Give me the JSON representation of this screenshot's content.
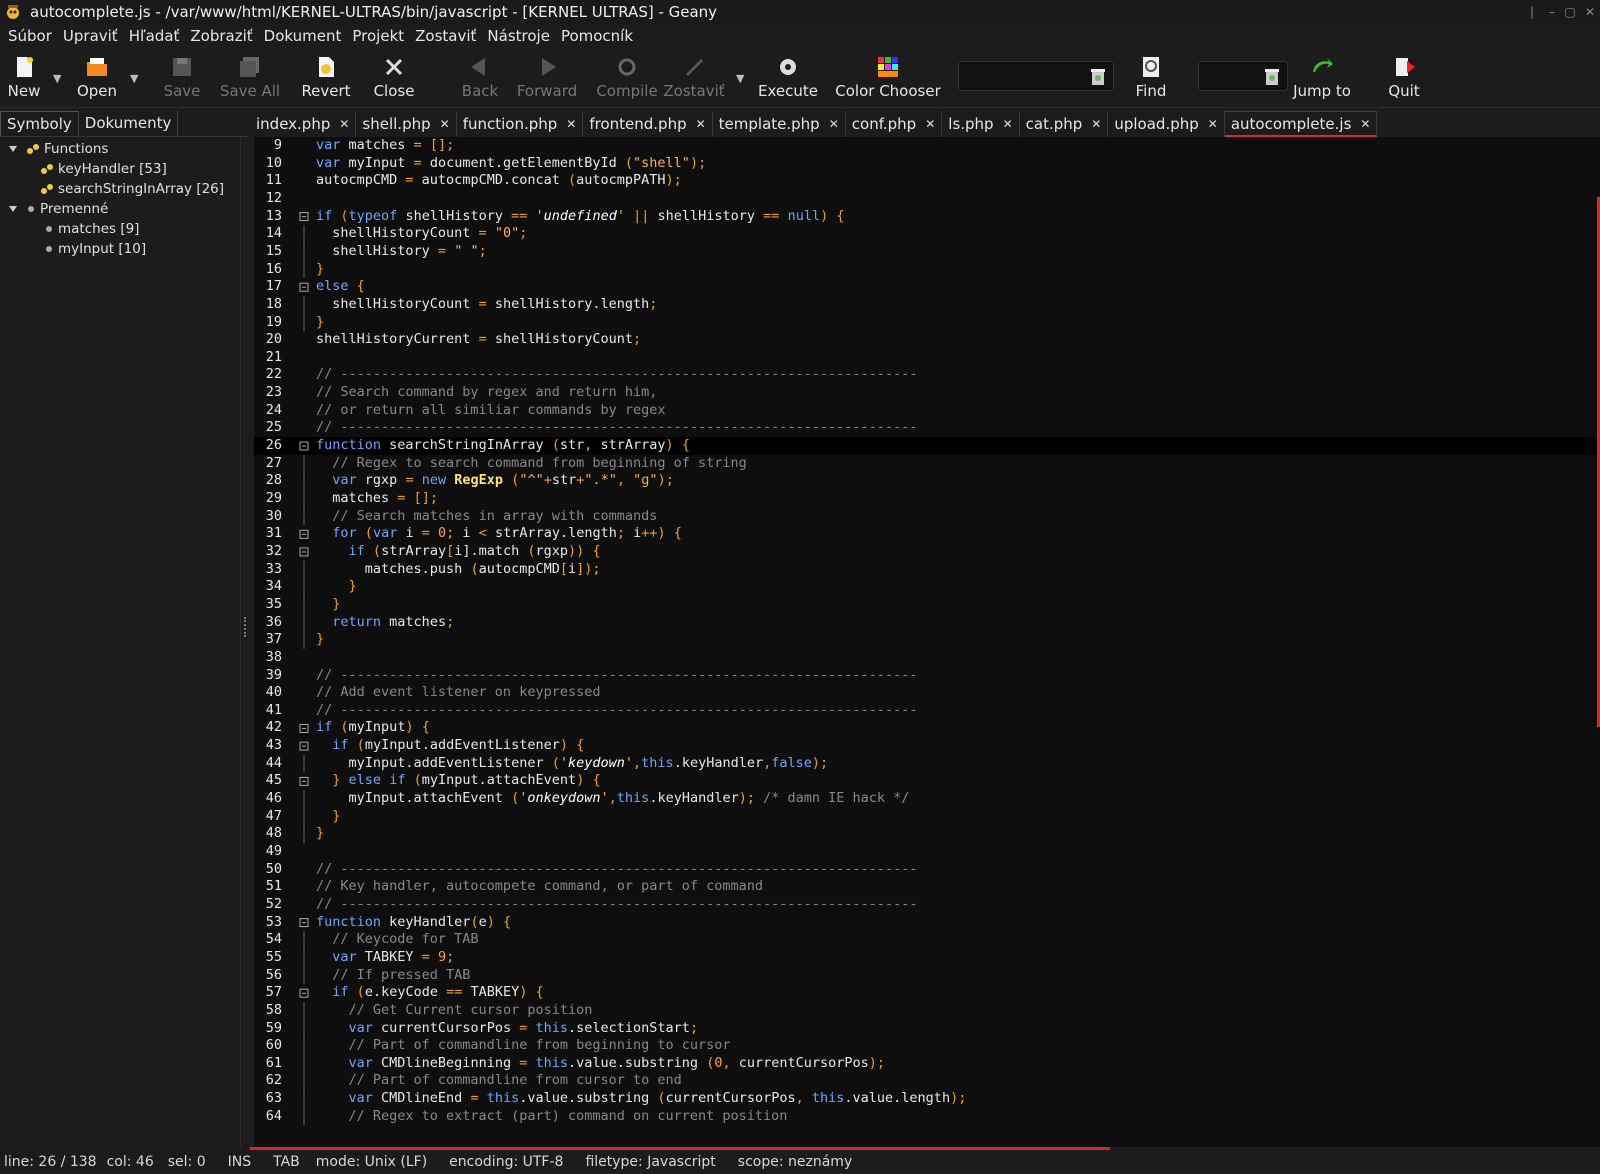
{
  "window": {
    "title": "autocomplete.js - /var/www/html/KERNEL-ULTRAS/bin/javascript - [KERNEL ULTRAS] - Geany"
  },
  "menu": [
    "Súbor",
    "Upraviť",
    "Hľadať",
    "Zobraziť",
    "Dokument",
    "Projekt",
    "Zostaviť",
    "Nástroje",
    "Pomocník"
  ],
  "toolbar": {
    "new": "New",
    "open": "Open",
    "save": "Save",
    "save_all": "Save All",
    "revert": "Revert",
    "close": "Close",
    "back": "Back",
    "forward": "Forward",
    "compile": "Compile",
    "build": "Zostaviť",
    "execute": "Execute",
    "color_chooser": "Color Chooser",
    "find": "Find",
    "jump_to": "Jump to",
    "quit": "Quit"
  },
  "sidebar": {
    "tabs": [
      "Symboly",
      "Dokumenty"
    ],
    "tree": {
      "functions_label": "Functions",
      "functions": [
        "keyHandler [53]",
        "searchStringInArray [26]"
      ],
      "variables_label": "Premenné",
      "variables": [
        "matches [9]",
        "myInput [10]"
      ]
    }
  },
  "doc_tabs": [
    "index.php",
    "shell.php",
    "function.php",
    "frontend.php",
    "template.php",
    "conf.php",
    "ls.php",
    "cat.php",
    "upload.php",
    "autocomplete.js"
  ],
  "editor": {
    "first_line": 9,
    "current_line": 26,
    "lines": [
      "var matches = [];",
      "var myInput = document.getElementById (\"shell\");",
      "autocmpCMD = autocmpCMD.concat (autocmpPATH);",
      "",
      "if (typeof shellHistory == 'undefined' || shellHistory == null) {",
      "  shellHistoryCount = \"0\";",
      "  shellHistory = \" \";",
      "}",
      "else {",
      "  shellHistoryCount = shellHistory.length;",
      "}",
      "shellHistoryCurrent = shellHistoryCount;",
      "",
      "// -----------------------------------------------------------------------",
      "// Search command by regex and return him,",
      "// or return all similiar commands by regex",
      "// -----------------------------------------------------------------------",
      "function searchStringInArray (str, strArray) {",
      "  // Regex to search command from beginning of string",
      "  var rgxp = new RegExp (\"^\"+str+\".*\", \"g\");",
      "  matches = [];",
      "  // Search matches in array with commands",
      "  for (var i = 0; i < strArray.length; i++) {",
      "    if (strArray[i].match (rgxp)) {",
      "      matches.push (autocmpCMD[i]);",
      "    }",
      "  }",
      "  return matches;",
      "}",
      "",
      "// -----------------------------------------------------------------------",
      "// Add event listener on keypressed",
      "// -----------------------------------------------------------------------",
      "if (myInput) {",
      "  if (myInput.addEventListener) {",
      "    myInput.addEventListener ('keydown',this.keyHandler,false);",
      "  } else if (myInput.attachEvent) {",
      "    myInput.attachEvent ('onkeydown',this.keyHandler); /* damn IE hack */",
      "  }",
      "}",
      "",
      "// -----------------------------------------------------------------------",
      "// Key handler, autocompete command, or part of command",
      "// -----------------------------------------------------------------------",
      "function keyHandler(e) {",
      "  // Keycode for TAB",
      "  var TABKEY = 9;",
      "  // If pressed TAB",
      "  if (e.keyCode == TABKEY) {",
      "    // Get Current cursor position",
      "    var currentCursorPos = this.selectionStart;",
      "    // Part of commandline from beginning to cursor",
      "    var CMDlineBeginning = this.value.substring (0, currentCursorPos);",
      "    // Part of commandline from cursor to end",
      "    var CMDlineEnd = this.value.substring (currentCursorPos, this.value.length);",
      "    // Regex to extract (part) command on current position"
    ]
  },
  "status": {
    "line": "line: 26 / 138",
    "col": "col: 46",
    "sel": "sel: 0",
    "ins": "INS",
    "tab": "TAB",
    "mode": "mode: Unix (LF)",
    "encoding": "encoding: UTF-8",
    "filetype": "filetype: Javascript",
    "scope": "scope: neznámy"
  },
  "colors": {
    "keyword": "#6ea6ff",
    "string": "#ffb347",
    "comment": "#888888",
    "accent": "#d02a2a"
  }
}
